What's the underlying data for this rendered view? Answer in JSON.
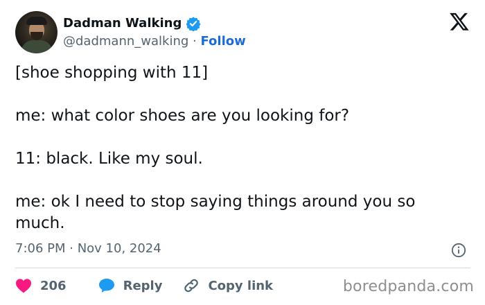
{
  "author": {
    "display_name": "Dadman Walking",
    "handle": "@dadmann_walking",
    "separator": "·",
    "follow_label": "Follow",
    "verified": true,
    "avatar_icon": "profile-photo"
  },
  "tweet": {
    "lines": [
      "[shoe shopping with 11]",
      "me: what color shoes are you looking for?",
      "11: black. Like my soul.",
      "me: ok I need to stop saying things around you so much."
    ],
    "timestamp": "7:06 PM · Nov 10, 2024"
  },
  "actions": {
    "like_count": "206",
    "reply_label": "Reply",
    "copy_label": "Copy link"
  },
  "icons": {
    "platform": "x-logo-icon",
    "verified": "verified-badge-icon",
    "info": "info-icon",
    "like": "heart-icon",
    "reply": "speech-bubble-icon",
    "copy": "link-icon"
  },
  "colors": {
    "text": "#0f1419",
    "muted": "#536471",
    "follow": "#1d6bd6",
    "verified": "#1d9bf0",
    "like": "#f91880",
    "reply": "#1d9bf0",
    "divider": "#cfd9de",
    "watermark": "#8e8e8e"
  },
  "watermark": "boredpanda.com"
}
